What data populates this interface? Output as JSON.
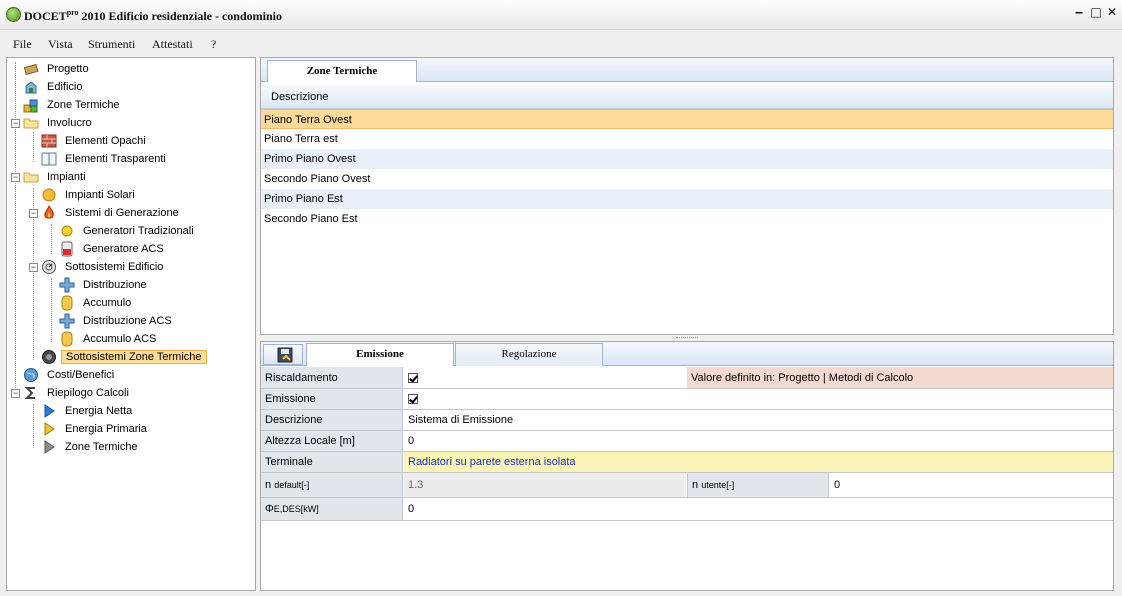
{
  "app": {
    "title_prefix": "DOCET",
    "title_sup": "pro",
    "title_rest": " 2010 Edificio residenziale - condominio",
    "min": "‒",
    "max": "□",
    "close": "✕"
  },
  "menu": [
    "File",
    "Vista",
    "Strumenti",
    "Attestati",
    "?"
  ],
  "tree": {
    "progetto": "Progetto",
    "edificio": "Edificio",
    "zone_termiche": "Zone Termiche",
    "involucro": "Involucro",
    "elementi_opachi": "Elementi Opachi",
    "elementi_trasparenti": "Elementi Trasparenti",
    "impianti": "Impianti",
    "impianti_solari": "Impianti Solari",
    "sistemi_generazione": "Sistemi di Generazione",
    "generatori_tradizionali": "Generatori Tradizionali",
    "generatore_acs": "Generatore ACS",
    "sottosistemi_edificio": "Sottosistemi Edificio",
    "distribuzione": "Distribuzione",
    "accumulo": "Accumulo",
    "distribuzione_acs": "Distribuzione ACS",
    "accumulo_acs": "Accumulo ACS",
    "sottosistemi_zone": "Sottosistemi Zone Termiche",
    "costi_benefici": "Costi/Benefici",
    "riepilogo_calcoli": "Riepilogo Calcoli",
    "energia_netta": "Energia Netta",
    "energia_primaria": "Energia Primaria",
    "zone_termiche_2": "Zone Termiche"
  },
  "zones_panel": {
    "tab": "Zone Termiche",
    "column": "Descrizione",
    "rows": [
      "Piano Terra Ovest",
      "Piano Terra est",
      "Primo Piano Ovest",
      "Secondo Piano Ovest",
      "Primo Piano Est",
      "Secondo Piano Est"
    ]
  },
  "props_panel": {
    "tab_emissione": "Emissione",
    "tab_regolazione": "Regolazione",
    "riscaldamento_label": "Riscaldamento",
    "riscaldamento_checked": true,
    "valore_definito": "Valore definito in: Progetto | Metodi di Calcolo",
    "emissione_label": "Emissione",
    "emissione_checked": true,
    "descrizione_label": "Descrizione",
    "descrizione_value": "Sistema di Emissione",
    "altezza_label": "Altezza Locale [m]",
    "altezza_value": "0",
    "terminale_label": "Terminale",
    "terminale_value": "Radiatori su parete esterna isolata",
    "n_default_symbol": "n",
    "n_default_sub": "default",
    "n_default_unit": " [-]",
    "n_default_value": "1.3",
    "n_utente_symbol": "n",
    "n_utente_sub": "utente",
    "n_utente_unit": " [-]",
    "n_utente_value": "0",
    "phi_symbol": "Φ",
    "phi_sub": "E,DES",
    "phi_unit": " [kW]",
    "phi_value": "0"
  }
}
